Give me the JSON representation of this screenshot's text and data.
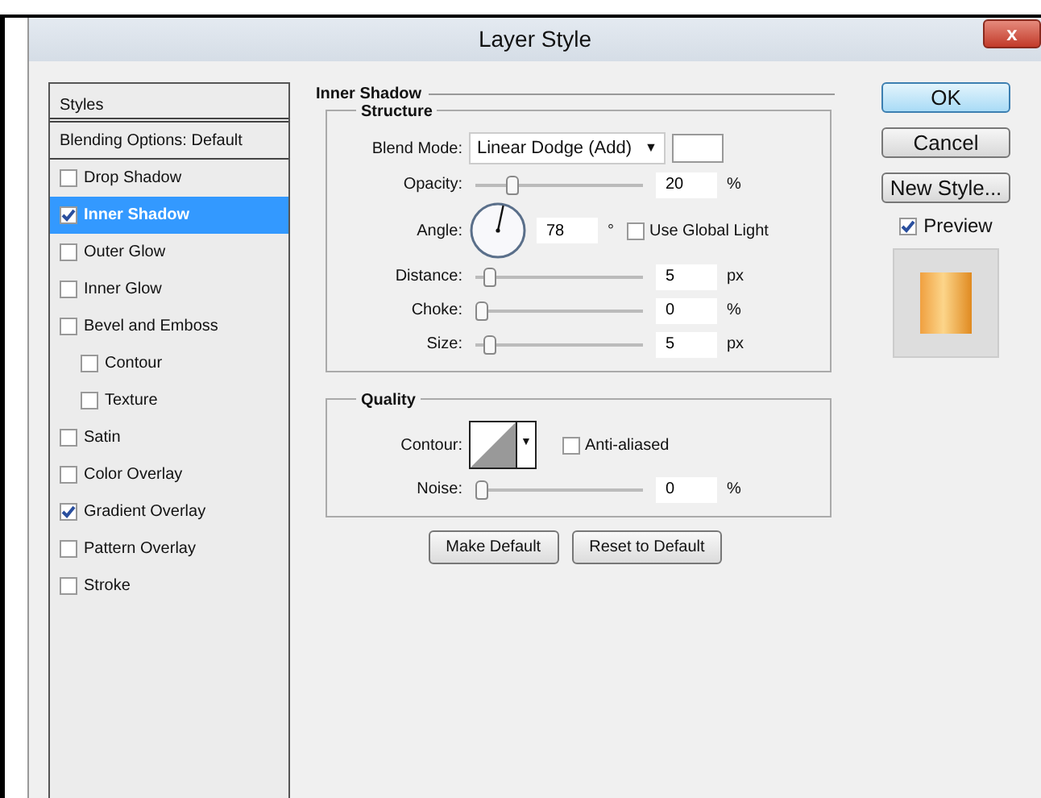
{
  "window": {
    "title": "Layer Style",
    "close": "x"
  },
  "styles": {
    "header": "Styles",
    "items": [
      {
        "label": "Blending Options: Default",
        "kind": "plain",
        "selected": false
      },
      {
        "label": "Drop Shadow",
        "kind": "checkbox",
        "checked": false,
        "selected": false
      },
      {
        "label": "Inner Shadow",
        "kind": "checkbox",
        "checked": true,
        "selected": true
      },
      {
        "label": "Outer Glow",
        "kind": "checkbox",
        "checked": false,
        "selected": false
      },
      {
        "label": "Inner Glow",
        "kind": "checkbox",
        "checked": false,
        "selected": false
      },
      {
        "label": "Bevel and Emboss",
        "kind": "checkbox",
        "checked": false,
        "selected": false,
        "children": [
          {
            "label": "Contour",
            "kind": "checkbox",
            "checked": false,
            "selected": false
          },
          {
            "label": "Texture",
            "kind": "checkbox",
            "checked": false,
            "selected": false
          }
        ]
      },
      {
        "label": "Satin",
        "kind": "checkbox",
        "checked": false,
        "selected": false
      },
      {
        "label": "Color Overlay",
        "kind": "checkbox",
        "checked": false,
        "selected": false
      },
      {
        "label": "Gradient Overlay",
        "kind": "checkbox",
        "checked": true,
        "selected": false
      },
      {
        "label": "Pattern Overlay",
        "kind": "checkbox",
        "checked": false,
        "selected": false
      },
      {
        "label": "Stroke",
        "kind": "checkbox",
        "checked": false,
        "selected": false
      }
    ]
  },
  "panel": {
    "title": "Inner Shadow",
    "structure": {
      "title": "Structure",
      "rows": [
        {
          "kind": "select",
          "label": "Blend Mode:",
          "value": "Linear Dodge (Add)",
          "arrow": "▼"
        },
        {
          "kind": "slider",
          "label": "Opacity:",
          "level": 0.2,
          "value": "20",
          "unit": "%"
        },
        {
          "kind": "angle",
          "label": "Angle:",
          "value": "78",
          "unit": "°",
          "option": "Use Global Light",
          "checked": false
        },
        {
          "kind": "slider",
          "label": "Distance:",
          "level": 0.05,
          "value": "5",
          "unit": "px"
        },
        {
          "kind": "slider",
          "label": "Choke:",
          "level": 0,
          "value": "0",
          "unit": "%"
        },
        {
          "kind": "slider",
          "label": "Size:",
          "level": 0.05,
          "value": "5",
          "unit": "px"
        }
      ]
    },
    "quality": {
      "title": "Quality",
      "rows": [
        {
          "kind": "contour",
          "label": "Contour:",
          "arrow": "▼",
          "option": "Anti-aliased",
          "checked": false
        },
        {
          "kind": "slider",
          "label": "Noise:",
          "level": 0,
          "value": "0",
          "unit": "%"
        }
      ]
    },
    "buttons": [
      "Make Default",
      "Reset to Default"
    ]
  },
  "actions": [
    {
      "label": "OK",
      "default": true
    },
    {
      "label": "Cancel",
      "default": false
    },
    {
      "label": "New Style...",
      "default": false
    }
  ],
  "preview": {
    "label": "Preview",
    "checked": true
  }
}
